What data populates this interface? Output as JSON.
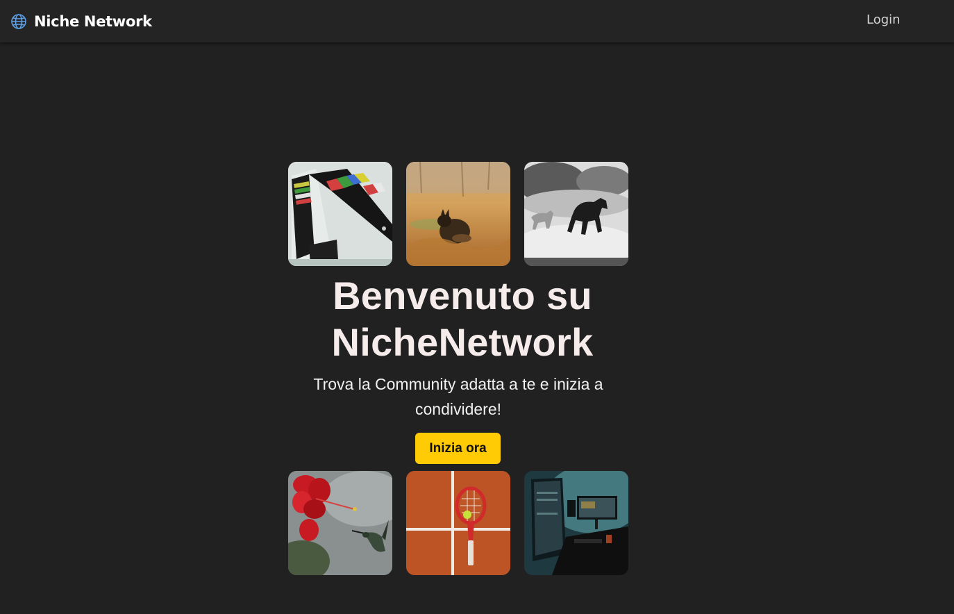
{
  "navbar": {
    "brand": "Niche Network",
    "login_label": "Login"
  },
  "hero": {
    "title": "Benvenuto su NicheNetwork",
    "subtitle": "Trova la Community adatta a te e inizia a condividere!",
    "cta_label": "Inizia ora"
  },
  "colors": {
    "background": "#212121",
    "navbar": "#242424",
    "accent": "#ffcb05",
    "title": "#f6ecec"
  },
  "icons": {
    "brand": "globe-icon"
  }
}
